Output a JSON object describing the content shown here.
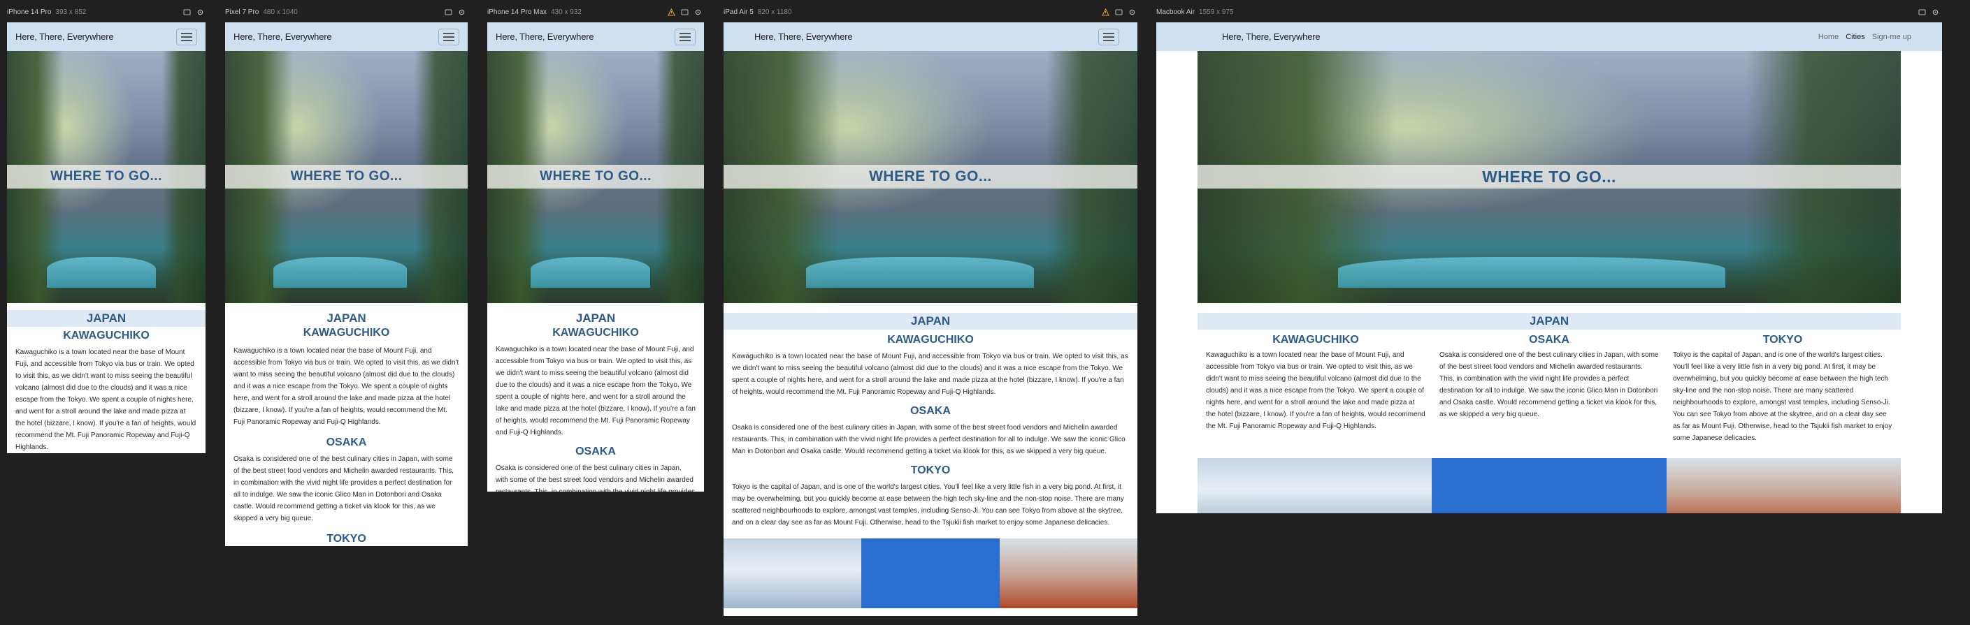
{
  "site": {
    "brand": "Here, There, Everywhere",
    "nav": [
      "Home",
      "Cities",
      "Sign-me up"
    ],
    "hero_title": "WHERE TO GO...",
    "country": "JAPAN"
  },
  "cities": [
    {
      "name": "KAWAGUCHIKO",
      "text": "Kawaguchiko is a town located near the base of Mount Fuji, and accessible from Tokyo via bus or train. We opted to visit this, as we didn't want to miss seeing the beautiful volcano (almost did due to the clouds) and it was a nice escape from the Tokyo. We spent a couple of nights here, and went for a stroll around the lake and made pizza at the hotel (bizzare, I know). If you're a fan of heights, would recommend the Mt. Fuji Panoramic Ropeway and Fuji-Q Highlands."
    },
    {
      "name": "OSAKA",
      "text": "Osaka is considered one of the best culinary cities in Japan, with some of the best street food vendors and Michelin awarded restaurants. This, in combination with the vivid night life provides a perfect destination for all to indulge. We saw the iconic Glico Man in Dotonbori and Osaka castle. Would recommend getting a ticket via klook for this, as we skipped a very big queue."
    },
    {
      "name": "TOKYO",
      "text": "Tokyo is the capital of Japan, and is one of the world's largest cities. You'll feel like a very little fish in a very big pond. At first, it may be overwhelming, but you quickly become at ease between the high tech sky-line and the non-stop noise. There are many scattered neighbourhoods to explore, amongst vast temples, including Senso-Ji. You can see Tokyo from above at the skytree, and on a clear day see as far as Mount Fuji. Otherwise, head to the Tsjukii fish market to enjoy some Japanese delicacies."
    }
  ],
  "devices": [
    {
      "name": "iPhone 14 Pro",
      "dims": "393 x 852"
    },
    {
      "name": "Pixel 7 Pro",
      "dims": "480 x 1040"
    },
    {
      "name": "iPhone 14 Pro Max",
      "dims": "430 x 932"
    },
    {
      "name": "iPad Air 5",
      "dims": "820 x 1180"
    },
    {
      "name": "Macbook Air",
      "dims": "1559 x 975"
    }
  ],
  "icons": {
    "device_icon": "tablet-icon",
    "settings_icon": "gear-icon",
    "warning_icon": "warning-icon",
    "menu_icon": "hamburger-menu-icon"
  },
  "colors": {
    "navbar_bg": "#cfe0f1",
    "heading": "#2d5a86",
    "warning": "#e0a030"
  }
}
